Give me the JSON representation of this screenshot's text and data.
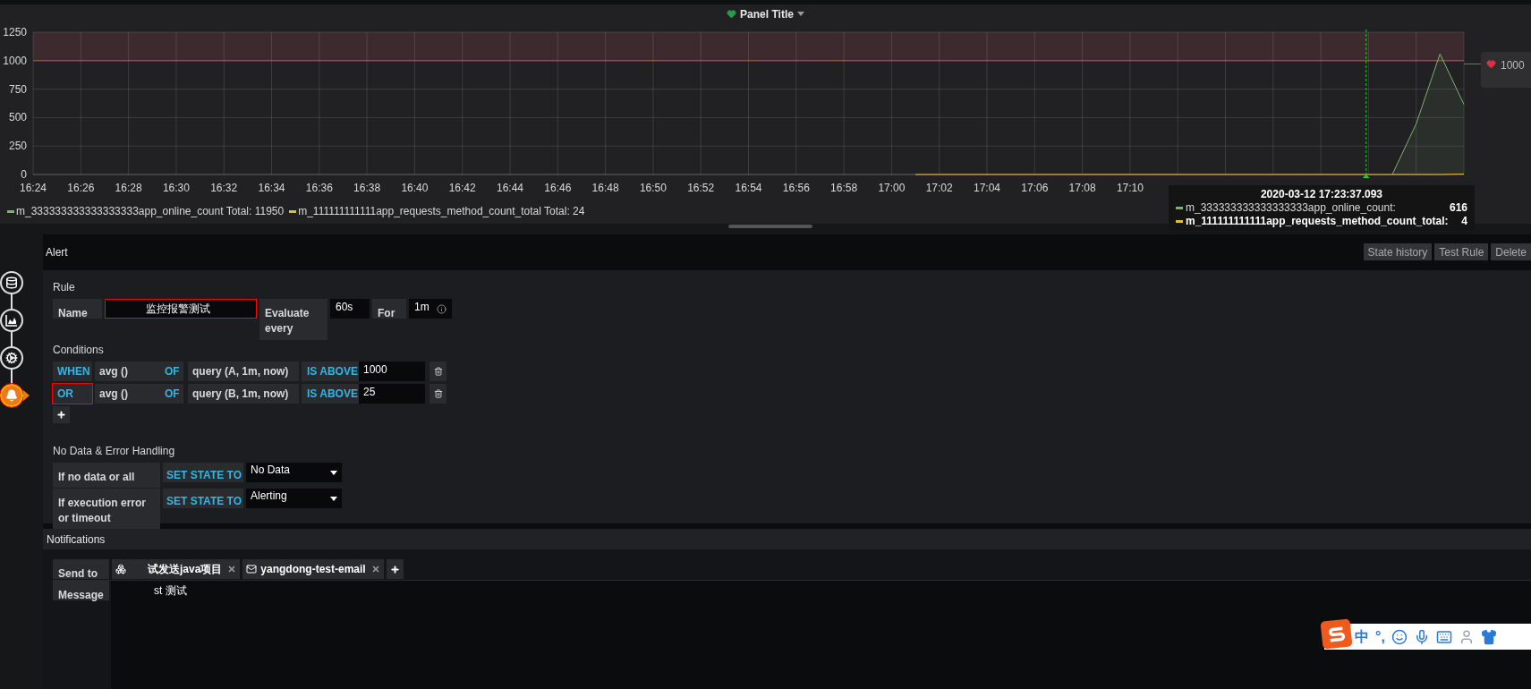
{
  "panel": {
    "title": "Panel Title"
  },
  "chart": {
    "chart_data": {
      "type": "line",
      "ylim": [
        0,
        1250
      ],
      "yticks": [
        0,
        250,
        500,
        750,
        1000,
        1250
      ],
      "categories": [
        "16:24",
        null,
        "16:26",
        null,
        "16:28",
        null,
        "16:30",
        null,
        "16:32",
        null,
        "16:34",
        null,
        "16:36",
        null,
        "16:38",
        null,
        "16:40",
        null,
        "16:42",
        null,
        "16:44",
        null,
        "16:46",
        null,
        "16:48",
        null,
        "16:50",
        null,
        "16:52",
        null,
        "16:54",
        null,
        "16:56",
        null,
        "16:58",
        null,
        "17:00",
        null,
        "17:02",
        null,
        "17:04",
        null,
        "17:06",
        null,
        "17:08",
        null,
        "17:10",
        null,
        null,
        null,
        null,
        null,
        null,
        null,
        null,
        null,
        null,
        null,
        null,
        null,
        null
      ],
      "series": [
        {
          "name": "m_333333333333333333app_online_count",
          "color": "#7eb26d",
          "values": [
            null,
            null,
            null,
            null,
            null,
            null,
            null,
            null,
            null,
            null,
            null,
            null,
            null,
            null,
            null,
            null,
            null,
            null,
            null,
            null,
            null,
            null,
            null,
            null,
            null,
            null,
            null,
            null,
            null,
            null,
            null,
            null,
            null,
            null,
            null,
            null,
            null,
            null,
            null,
            null,
            null,
            null,
            null,
            null,
            null,
            null,
            null,
            null,
            null,
            null,
            null,
            null,
            null,
            null,
            null,
            null,
            null,
            0,
            445,
            1060,
            616
          ]
        },
        {
          "name": "m_111111111111app_requests_method_count_total",
          "color": "#eab839",
          "values": [
            null,
            null,
            null,
            null,
            null,
            null,
            null,
            null,
            null,
            null,
            null,
            null,
            null,
            null,
            null,
            null,
            null,
            null,
            null,
            null,
            null,
            null,
            null,
            null,
            null,
            null,
            null,
            null,
            null,
            null,
            null,
            null,
            null,
            null,
            null,
            null,
            null,
            0,
            0,
            0,
            0,
            0,
            0,
            0,
            0,
            0,
            0,
            0,
            0,
            0,
            0,
            0,
            0,
            0,
            0,
            0,
            0,
            0,
            0,
            0,
            4
          ]
        }
      ],
      "grid": true,
      "ref_lines": [
        {
          "axis": "y",
          "value": 1000,
          "color": "#d44a3a"
        }
      ],
      "bands": [
        {
          "axis": "y",
          "from": 1000,
          "to": 1250,
          "color": "#3d2a2e"
        }
      ]
    }
  },
  "threshold_handle": {
    "value": "1000"
  },
  "legend": [
    {
      "total": "Total: 11950"
    },
    {
      "total": "Total: 24"
    }
  ],
  "tooltip": {
    "time": "2020-03-12 17:23:37.093",
    "rows": [
      {
        "name": "m_333333333333333333app_online_count:",
        "value": "616",
        "color": "#7eb26d",
        "selected": false
      },
      {
        "name": "m_111111111111app_requests_method_count_total:",
        "value": "4",
        "color": "#eab839",
        "selected": true
      }
    ]
  },
  "steps": [
    {
      "kind": "queries",
      "selected": false,
      "highlighted": false
    },
    {
      "kind": "visualization",
      "selected": false,
      "highlighted": false
    },
    {
      "kind": "general",
      "selected": false,
      "highlighted": false
    },
    {
      "kind": "alert",
      "selected": true,
      "highlighted": true
    }
  ],
  "alert": {
    "title": "Alert",
    "actions": [
      "State history",
      "Test Rule",
      "Delete"
    ],
    "rule": {
      "heading": "Rule",
      "name_label": "Name",
      "name_value": "监控报警测试",
      "name_highlighted": true,
      "evaluate_label": "Evaluate every",
      "evaluate_value": "60s",
      "for_label": "For",
      "for_value": "1m"
    },
    "conditions": {
      "heading": "Conditions",
      "rows": [
        {
          "operator": "WHEN",
          "highlighted": false,
          "reducer": "avg ()",
          "of": "OF",
          "query": "query (A, 1m, now)",
          "evaluator": "IS ABOVE",
          "threshold": "1000"
        },
        {
          "operator": "OR",
          "highlighted": true,
          "reducer": "avg ()",
          "of": "OF",
          "query": "query (B, 1m, now)",
          "evaluator": "IS ABOVE",
          "threshold": "25"
        }
      ]
    },
    "no_data": {
      "heading": "No Data & Error Handling",
      "rows": [
        {
          "label": "If no data or all",
          "action": "SET STATE TO",
          "value": "No Data"
        },
        {
          "label": "If execution error or timeout",
          "action": "SET STATE TO",
          "value": "Alerting"
        }
      ]
    }
  },
  "notifications": {
    "title": "Notifications",
    "send_to_label": "Send to",
    "targets": [
      {
        "kind": "group",
        "name": "试发送java项目"
      },
      {
        "kind": "email",
        "name": "yangdong-test-email"
      }
    ],
    "message_label": "Message",
    "message": "st 测试"
  },
  "ime_toolbar": {
    "mode": "中",
    "punctuation": "°,"
  }
}
